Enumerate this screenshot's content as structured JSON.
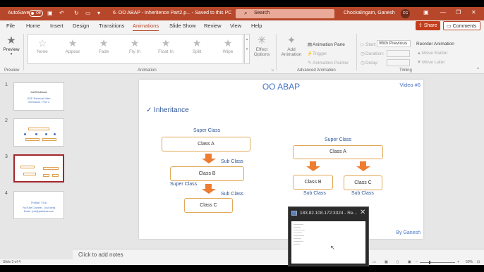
{
  "titlebar": {
    "autosave_label": "AutoSave",
    "autosave_state": "Off",
    "doc_title": "6. OO ABAP - Inheritence Part2.p... - Saved to this PC",
    "search_placeholder": "Search",
    "user_name": "Chockalingam, Ganesh",
    "user_initials": "CG"
  },
  "tabs": [
    "File",
    "Home",
    "Insert",
    "Design",
    "Transitions",
    "Animations",
    "Slide Show",
    "Review",
    "View",
    "Help"
  ],
  "active_tab": "Animations",
  "share_label": "Share",
  "comments_label": "Comments",
  "ribbon": {
    "preview_label": "Preview",
    "preview_group": "Preview",
    "animations": [
      "None",
      "Appear",
      "Fade",
      "Fly In",
      "Float In",
      "Split",
      "Wipe"
    ],
    "animation_group": "Animation",
    "effect_options": "Effect Options",
    "add_animation": "Add Animation",
    "animation_pane": "Animation Pane",
    "trigger": "Trigger",
    "animation_painter": "Animation Painter",
    "advanced_group": "Advanced Animation",
    "start_label": "Start:",
    "start_value": "With Previous",
    "duration_label": "Duration:",
    "delay_label": "Delay:",
    "timing_group": "Timing",
    "reorder_label": "Reorder Animation",
    "move_earlier": "Move Earlier",
    "move_later": "Move Later"
  },
  "thumbnails": {
    "numbers": [
      "1",
      "2",
      "3",
      "4"
    ],
    "selected": 3,
    "t1_title": "JustTeSoftware",
    "t1_sub1": "OOP Technical Video",
    "t1_sub2": "Inheritance - Part 2",
    "t4_title": "THANK YOU",
    "t4_sub1": "YouTube Channel - Just Ideas",
    "t4_sub2": "Email - just@justideas.com"
  },
  "slide": {
    "title": "OO ABAP",
    "video_tag": "Video #6",
    "heading": "✓ Inheritance",
    "footer": "By Ganesh",
    "left": {
      "super1": "Super Class",
      "class_a": "Class A",
      "sub1": "Sub Class",
      "class_b": "Class B",
      "super2": "Super Class",
      "sub2": "Sub Class",
      "class_c": "Class C"
    },
    "right": {
      "super": "Super Class",
      "class_a": "Class A",
      "class_b": "Class B",
      "class_c": "Class C",
      "sub_b": "Sub Class",
      "sub_c": "Sub Class"
    }
  },
  "notes_placeholder": "Click to add notes",
  "status": {
    "slide_info": "Slide 3 of 4",
    "zoom": "50%"
  },
  "remote": {
    "title": "183.82.108.172:3324 - Re..."
  }
}
